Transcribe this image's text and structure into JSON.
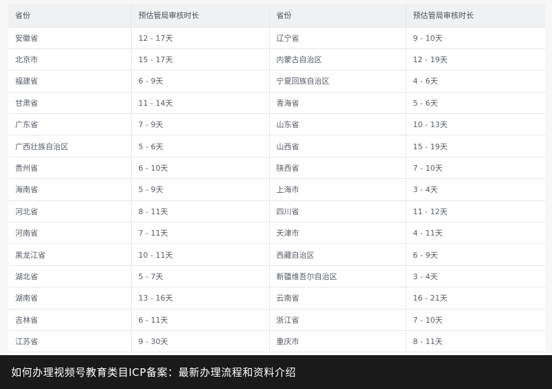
{
  "table": {
    "headers": [
      "省份",
      "预估管局审核时长",
      "省份",
      "预估管局审核时长"
    ],
    "rows": [
      [
        "安徽省",
        "12 - 17天",
        "辽宁省",
        "9 - 10天"
      ],
      [
        "北京市",
        "15 - 17天",
        "内蒙古自治区",
        "12 - 19天"
      ],
      [
        "福建省",
        "6 - 9天",
        "宁夏回族自治区",
        "4 - 6天"
      ],
      [
        "甘肃省",
        "11 - 14天",
        "青海省",
        "5 - 6天"
      ],
      [
        "广东省",
        "7 - 9天",
        "山东省",
        "10 - 13天"
      ],
      [
        "广西壮族自治区",
        "5 - 6天",
        "山西省",
        "15 - 19天"
      ],
      [
        "贵州省",
        "6 - 10天",
        "陕西省",
        "7 - 10天"
      ],
      [
        "海南省",
        "5 - 9天",
        "上海市",
        "3 - 4天"
      ],
      [
        "河北省",
        "8 - 11天",
        "四川省",
        "11 - 12天"
      ],
      [
        "河南省",
        "7 - 11天",
        "天津市",
        "4 - 11天"
      ],
      [
        "黑龙江省",
        "10 - 11天",
        "西藏自治区",
        "6 - 9天"
      ],
      [
        "湖北省",
        "5 - 7天",
        "新疆维吾尔自治区",
        "3 - 4天"
      ],
      [
        "湖南省",
        "13 - 16天",
        "云南省",
        "16 - 21天"
      ],
      [
        "吉林省",
        "6 - 11天",
        "浙江省",
        "7 - 10天"
      ],
      [
        "江苏省",
        "9 - 30天",
        "重庆市",
        "8 - 11天"
      ]
    ]
  },
  "caption": {
    "text": "如何办理视频号教育类目ICP备案：最新办理流程和资料介绍"
  }
}
